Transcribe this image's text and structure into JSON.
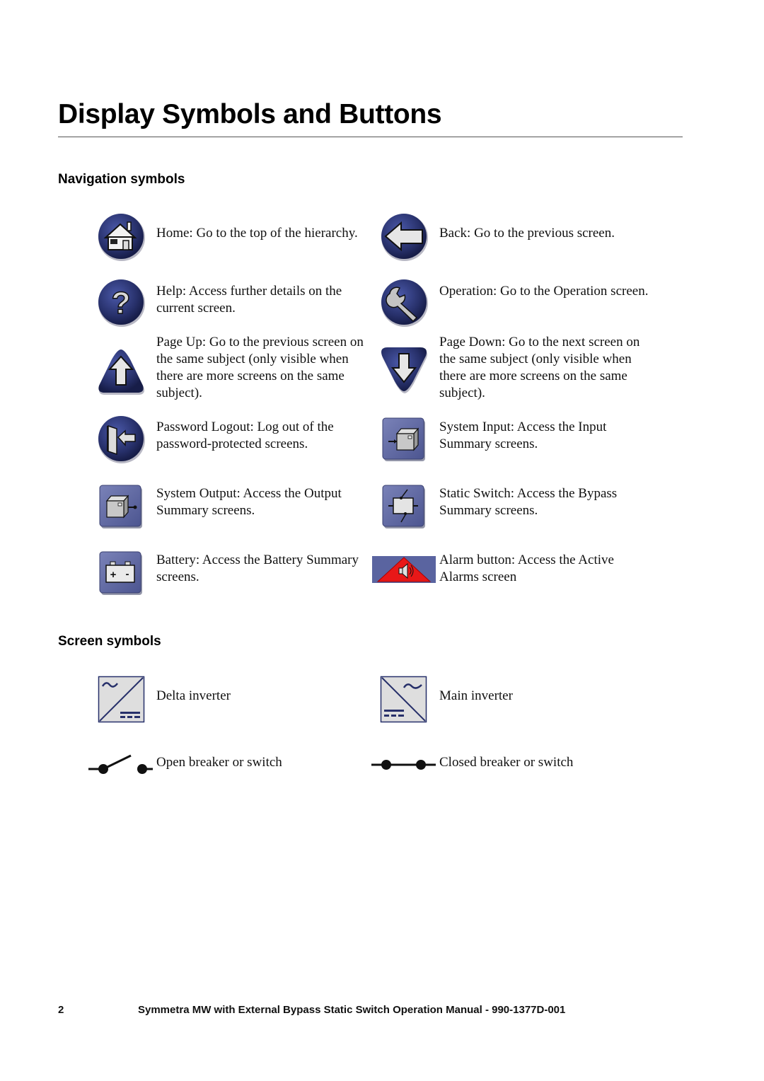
{
  "page": {
    "title": "Display Symbols and Buttons"
  },
  "sections": {
    "navigation": {
      "heading": "Navigation symbols",
      "items": [
        {
          "icon": "home-icon",
          "text": "Home: Go to the top of the hierarchy."
        },
        {
          "icon": "back-arrow-icon",
          "text": "Back: Go to the previous screen."
        },
        {
          "icon": "help-icon",
          "text": "Help: Access further details on the current screen."
        },
        {
          "icon": "wrench-icon",
          "text": "Operation: Go to the Operation screen."
        },
        {
          "icon": "page-up-icon",
          "text": "Page Up: Go to the previous screen on the same subject (only visible when there are more screens on the same subject)."
        },
        {
          "icon": "page-down-icon",
          "text": "Page Down: Go to the next screen on the same subject (only visible when there are more screens on the same subject)."
        },
        {
          "icon": "logout-icon",
          "text": "Password Logout: Log out of the password-protected screens."
        },
        {
          "icon": "system-input-icon",
          "text": "System Input: Access the Input Summary screens."
        },
        {
          "icon": "system-output-icon",
          "text": "System Output: Access the Output Summary screens."
        },
        {
          "icon": "static-switch-icon",
          "text": "Static Switch: Access the Bypass Summary screens."
        },
        {
          "icon": "battery-icon",
          "text": "Battery: Access the Battery Summary screens."
        },
        {
          "icon": "alarm-icon",
          "text": "Alarm button: Access the Active Alarms screen"
        }
      ]
    },
    "screen": {
      "heading": "Screen symbols",
      "items": [
        {
          "icon": "delta-inverter-icon",
          "text": "Delta inverter"
        },
        {
          "icon": "main-inverter-icon",
          "text": "Main inverter"
        },
        {
          "icon": "open-breaker-icon",
          "text": "Open breaker or switch"
        },
        {
          "icon": "closed-breaker-icon",
          "text": "Closed breaker or switch"
        }
      ]
    }
  },
  "footer": {
    "page_number": "2",
    "document_title": "Symmetra MW with External Bypass Static Switch Operation Manual - 990-1377D-001"
  },
  "colors": {
    "button_blue": "#2e3a7a",
    "square_button": "#5b65a0",
    "alarm_red": "#e81818",
    "icon_light": "#e8e8e8"
  }
}
